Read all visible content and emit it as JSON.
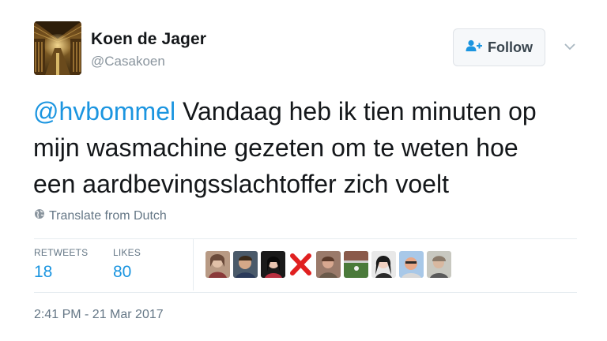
{
  "user": {
    "name": "Koen de Jager",
    "handle": "@Casakoen"
  },
  "follow_button": {
    "label": "Follow",
    "icon": "add-user-icon"
  },
  "menu_icon": "chevron-down-icon",
  "tweet": {
    "mention": "@hvbommel",
    "text_line1": " Vandaag heb ik tien minuten op",
    "text_line2": "mijn wasmachine gezeten om te weten hoe",
    "text_line3": "een aardbevingsslachtoffer zich voelt"
  },
  "translate": {
    "label": "Translate from Dutch",
    "icon": "globe-icon"
  },
  "stats": {
    "retweets_label": "RETWEETS",
    "retweets_value": "18",
    "likes_label": "LIKES",
    "likes_value": "80"
  },
  "timestamp": "2:41 PM - 21 Mar 2017",
  "colors": {
    "link": "#1b95e0",
    "muted": "#657786",
    "text": "#14171a",
    "border": "#e6ecf0"
  }
}
